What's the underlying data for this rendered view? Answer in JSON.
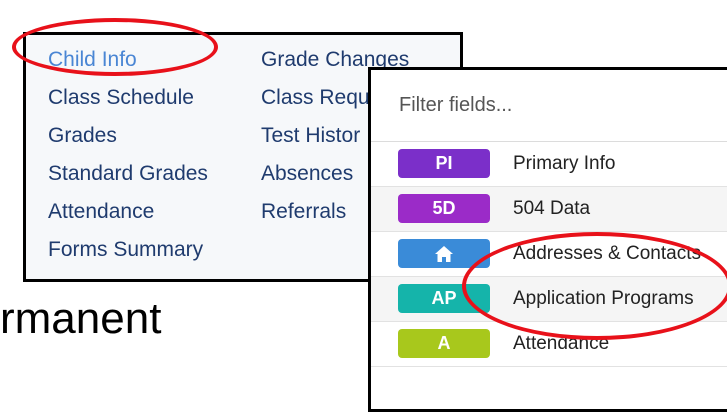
{
  "background_text": "rmanent",
  "child_menu": {
    "column1": [
      "Child Info",
      "Class Schedule",
      "Grades",
      "Standard Grades",
      "Attendance",
      "Forms Summary"
    ],
    "column2": [
      "Grade Changes",
      "Class Requ",
      "Test Histor",
      "Absences",
      "Referrals"
    ],
    "active_item": "Child Info"
  },
  "filter": {
    "placeholder": "Filter fields..."
  },
  "fields": [
    {
      "badge": "PI",
      "label": "Primary Info",
      "color": "#7b2fc9",
      "icon": ""
    },
    {
      "badge": "5D",
      "label": "504 Data",
      "color": "#9b2bc8",
      "icon": ""
    },
    {
      "badge": "",
      "label": "Addresses & Contacts",
      "color": "#3a8bd8",
      "icon": "home-icon"
    },
    {
      "badge": "AP",
      "label": "Application Programs",
      "color": "#15b4aa",
      "icon": ""
    },
    {
      "badge": "A",
      "label": "Attendance",
      "color": "#a8c81c",
      "icon": ""
    }
  ],
  "annotation_color": "#e8111a"
}
